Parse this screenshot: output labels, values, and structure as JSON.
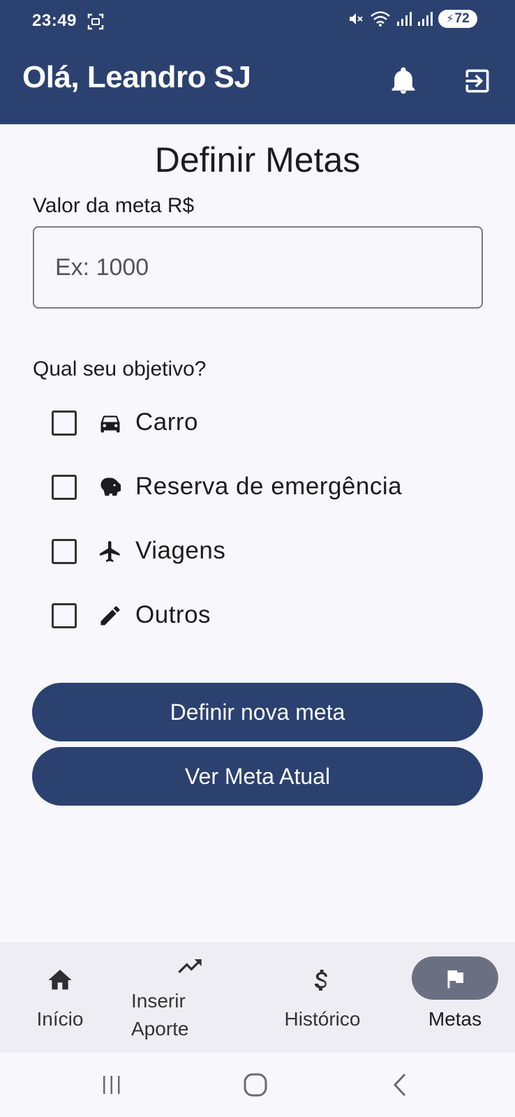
{
  "status_bar": {
    "time": "23:49",
    "battery": "72",
    "icons": [
      "screenshot-icon",
      "mute-icon",
      "wifi-icon",
      "signal-icon",
      "signal-icon",
      "battery-icon"
    ]
  },
  "app_bar": {
    "title": "Olá, Leandro SJ",
    "icons": [
      "bell-icon",
      "logout-icon"
    ]
  },
  "form": {
    "title": "Definir Metas",
    "value_label": "Valor da meta R$",
    "value_placeholder": "Ex: 1000",
    "value": "",
    "objective_label": "Qual seu objetivo?",
    "options": [
      {
        "label": "Carro",
        "icon": "car-icon",
        "checked": false
      },
      {
        "label": "Reserva de emergência",
        "icon": "piggy-bank-icon",
        "checked": false
      },
      {
        "label": "Viagens",
        "icon": "airplane-icon",
        "checked": false
      },
      {
        "label": "Outros",
        "icon": "pencil-icon",
        "checked": false
      }
    ],
    "primary_button": "Definir nova meta",
    "secondary_button": "Ver Meta Atual"
  },
  "bottom_nav": {
    "items": [
      {
        "label": "Início",
        "icon": "home-icon"
      },
      {
        "label": "Inserir Aporte",
        "icon": "trending-up-icon"
      },
      {
        "label": "Histórico",
        "icon": "dollar-icon"
      },
      {
        "label": "Metas",
        "icon": "flag-icon",
        "selected": true
      }
    ]
  },
  "colors": {
    "primary": "#2b4170",
    "background": "#f8f8fc",
    "nav_background": "#eeedf3",
    "nav_selected_pill": "#6a6f82"
  }
}
